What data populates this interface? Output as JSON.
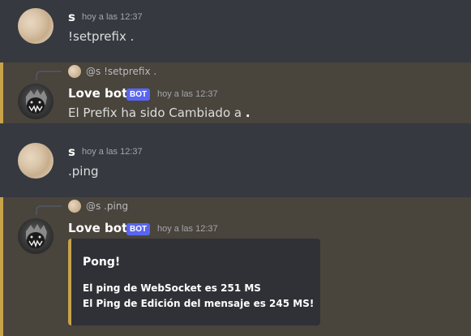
{
  "messages": [
    {
      "author": "s",
      "timestamp": "hoy a las 12:37",
      "content": "!setprefix ."
    },
    {
      "author": "Love bot",
      "badge": "BOT",
      "timestamp": "hoy a las 12:37",
      "reply": {
        "author": "@s",
        "text": "!setprefix ."
      },
      "content_prefix": "El Prefix ha sido Cambiado a",
      "content_value": "."
    },
    {
      "author": "s",
      "timestamp": "hoy a las 12:37",
      "content": ".ping"
    },
    {
      "author": "Love bot",
      "badge": "BOT",
      "timestamp": "hoy a las 12:37",
      "reply": {
        "author": "@s",
        "text": ".ping"
      },
      "embed": {
        "title": "Pong!",
        "lines": [
          "El ping de WebSocket es 251 MS",
          "El Ping de Edición del mensaje es 245 MS!"
        ]
      }
    }
  ],
  "colors": {
    "background": "#36393f",
    "highlight": "#49443c",
    "accent": "#c9a34a",
    "badge": "#5865f2"
  }
}
